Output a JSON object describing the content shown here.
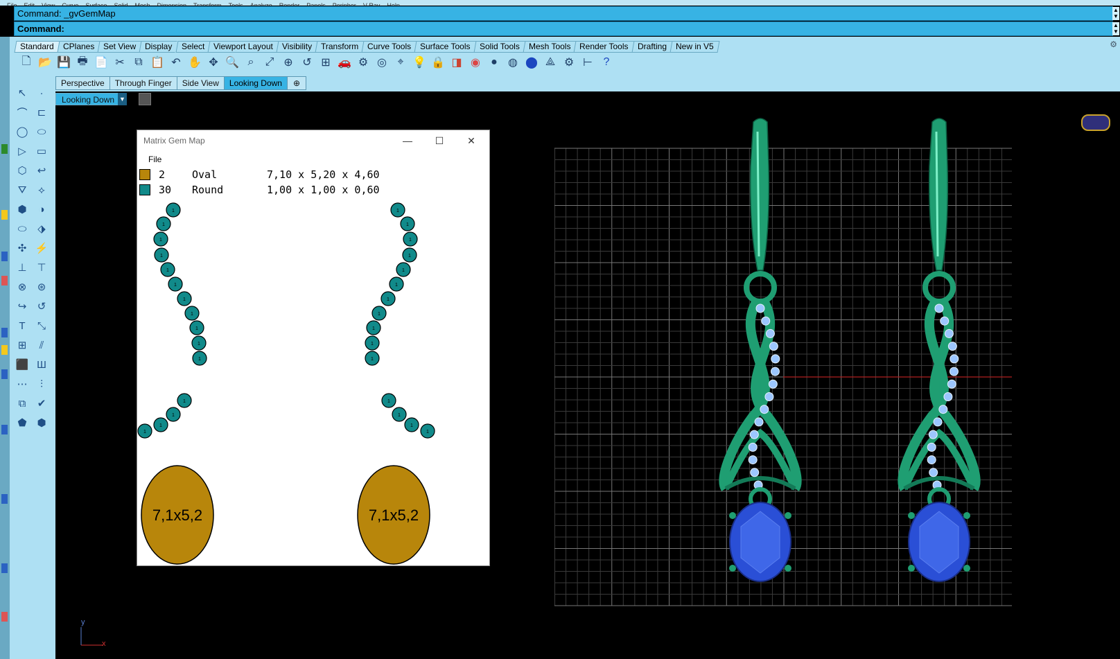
{
  "menubar": {
    "items": [
      "File",
      "Edit",
      "View",
      "Curve",
      "Surface",
      "Solid",
      "Mesh",
      "Dimension",
      "Transform",
      "Tools",
      "Analyze",
      "Render",
      "Panels",
      "Peripher",
      "V-Ray",
      "Help"
    ]
  },
  "command": {
    "history_text": "Command: _gvGemMap",
    "prompt_label": "Command:"
  },
  "toolbar_tabs": [
    "Standard",
    "CPlanes",
    "Set View",
    "Display",
    "Select",
    "Viewport Layout",
    "Visibility",
    "Transform",
    "Curve Tools",
    "Surface Tools",
    "Solid Tools",
    "Mesh Tools",
    "Render Tools",
    "Drafting",
    "New in V5"
  ],
  "toolbar_active_tab": "Standard",
  "standard_icons": [
    "new-file-icon",
    "open-folder-icon",
    "save-icon",
    "print-icon",
    "import-icon",
    "cut-icon",
    "copy-icon",
    "paste-icon",
    "undo-icon",
    "pan-hand-icon",
    "rotate-view-icon",
    "zoom-icon",
    "zoom-window-icon",
    "zoom-extents-icon",
    "zoom-selected-icon",
    "undo-view-icon",
    "four-viewports-icon",
    "car-icon",
    "options-icon",
    "snap-icon",
    "object-snap-icon",
    "light-bulb-icon",
    "lock-icon",
    "layer-icon",
    "color-wheel-icon",
    "shaded-sphere-icon",
    "rendered-sphere-icon",
    "render-blue-icon",
    "select-filter-icon",
    "gear-icon",
    "dimension-icon",
    "help-icon"
  ],
  "viewport_tabs": [
    "Perspective",
    "Through Finger",
    "Side View",
    "Looking Down"
  ],
  "viewport_active_tab": "Looking Down",
  "viewport_title": "Looking Down",
  "gem_map": {
    "title": "Matrix Gem Map",
    "menu_file": "File",
    "legend": [
      {
        "count": "2",
        "shape": "Oval",
        "dims": "7,10 x 5,20 x 4,60",
        "color": "#b8860b"
      },
      {
        "count": "30",
        "shape": "Round",
        "dims": "1,00 x 1,00 x 0,60",
        "color": "#118a8a"
      }
    ],
    "oval_label": "7,1x5,2",
    "round_label": "1"
  },
  "window_controls": {
    "minimize": "—",
    "maximize": "☐",
    "close": "✕"
  },
  "axis": {
    "y": "y",
    "x": "x"
  },
  "colors": {
    "command_bg": "#37b3e4",
    "toolbar_bg": "#aee0f3",
    "gem_round": "#118a8a",
    "gem_oval": "#b8860b",
    "metal": "#1f9e72",
    "sapphire": "#2a4fd6",
    "diamond": "#9cc6ff"
  }
}
